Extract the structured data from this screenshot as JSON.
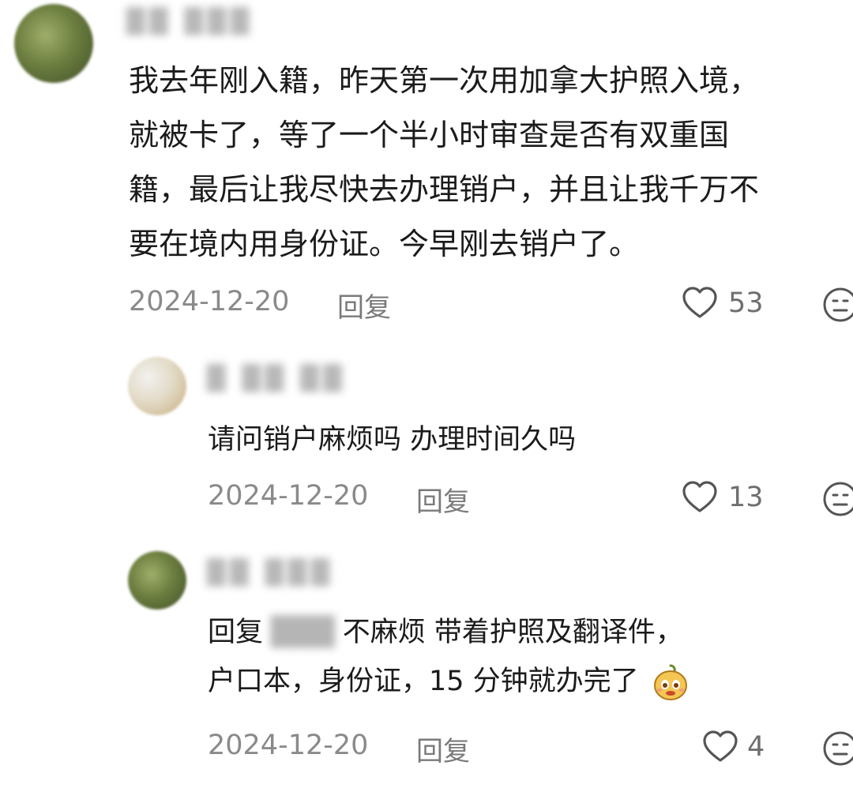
{
  "comments": [
    {
      "username": "██ ███",
      "lines": [
        "我去年刚入籍，昨天第一次用加拿大护照入境，",
        "就被卡了，等了一个半小时审查是否有双重国",
        "籍，最后让我尽快去办理销户，并且让我千万不",
        "要在境内用身份证。今早刚去销户了。"
      ],
      "date": "2024-12-20",
      "reply_label": "回复",
      "likes": "53"
    },
    {
      "username": "█ ██ ██",
      "lines": [
        "请问销户麻烦吗 办理时间久吗"
      ],
      "date": "2024-12-20",
      "reply_label": "回复",
      "likes": "13"
    },
    {
      "username": "██ ███",
      "reply_prefix": "回复",
      "reply_target": "███",
      "lines": [
        "不麻烦 带着护照及翻译件，",
        "户口本，身份证，15 分钟就办完了"
      ],
      "date": "2024-12-20",
      "reply_label": "回复",
      "likes": "4"
    }
  ],
  "icons": {
    "like": "heart-outline-icon",
    "dislike": "neutral-face-icon",
    "emoji": "cartoon-face-emoji"
  },
  "colors": {
    "text": "#1b1b1b",
    "meta": "#8a8a8a",
    "icon": "#555555"
  }
}
